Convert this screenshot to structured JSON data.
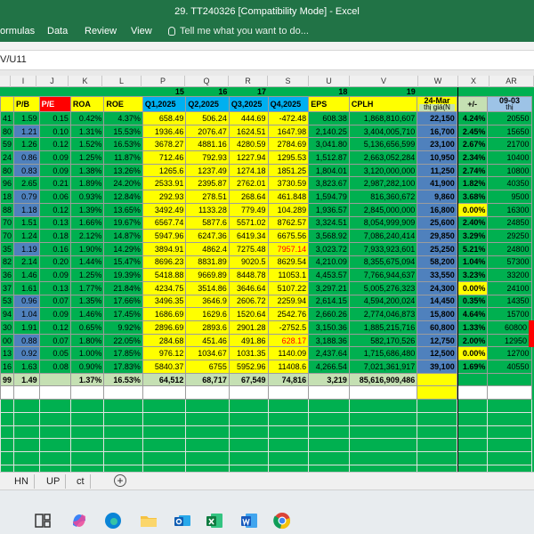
{
  "window": {
    "title": "29. TT240326  [Compatibility Mode] - Excel"
  },
  "ribbon": {
    "tabs": [
      "ormulas",
      "Data",
      "Review",
      "View"
    ],
    "tell_me": "Tell me what you want to do..."
  },
  "formula_bar": {
    "name_box": "V/U11"
  },
  "column_headers": [
    "I",
    "J",
    "K",
    "L",
    "P",
    "Q",
    "R",
    "S",
    "U",
    "V",
    "W",
    "X",
    "AR"
  ],
  "number_row": [
    "15",
    "16",
    "17",
    "18",
    "19"
  ],
  "header_row": {
    "pb": "P/B",
    "pe": "P/E",
    "roa": "ROA",
    "roe": "ROE",
    "q1": "Q1,2025",
    "q2": "Q2,2025",
    "q3": "Q3,2025",
    "q4": "Q4,2025",
    "eps": "EPS",
    "cplh": "CPLH",
    "date1": "24-Mar",
    "thi_gia": "thị giá(N",
    "pct": "+/-",
    "date2": "09-03",
    "thi": "thị"
  },
  "rows": [
    {
      "a": "41",
      "pb": "1.59",
      "pe": "0.15",
      "roa": "0.42%",
      "roe": "4.37%",
      "q1": "658.49",
      "q2": "506.24",
      "q3": "444.69",
      "q4": "-472.48",
      "eps": "608.38",
      "cplh": "1,868,810,607",
      "price": "22,150",
      "pct": "4.24%",
      "ar": "20550"
    },
    {
      "a": "80",
      "pb": "1.21",
      "pe": "0.10",
      "roa": "1.31%",
      "roe": "15.53%",
      "q1": "1936.46",
      "q2": "2076.47",
      "q3": "1624.51",
      "q4": "1647.98",
      "eps": "2,140.25",
      "cplh": "3,404,005,710",
      "price": "16,700",
      "pct": "2.45%",
      "ar": "15650"
    },
    {
      "a": "59",
      "pb": "1.26",
      "pe": "0.12",
      "roa": "1.52%",
      "roe": "16.53%",
      "q1": "3678.27",
      "q2": "4881.16",
      "q3": "4280.59",
      "q4": "2784.69",
      "eps": "3,041.80",
      "cplh": "5,136,656,599",
      "price": "23,100",
      "pct": "2.67%",
      "ar": "21700"
    },
    {
      "a": "24",
      "pb": "0.86",
      "pe": "0.09",
      "roa": "1.25%",
      "roe": "11.87%",
      "q1": "712.46",
      "q2": "792.93",
      "q3": "1227.94",
      "q4": "1295.53",
      "eps": "1,512.87",
      "cplh": "2,663,052,284",
      "price": "10,950",
      "pct": "2.34%",
      "ar": "10400"
    },
    {
      "a": "80",
      "pb": "0.83",
      "pe": "0.09",
      "roa": "1.38%",
      "roe": "13.26%",
      "q1": "1265.6",
      "q2": "1237.49",
      "q3": "1274.18",
      "q4": "1851.25",
      "eps": "1,804.01",
      "cplh": "3,120,000,000",
      "price": "11,250",
      "pct": "2.74%",
      "ar": "10800"
    },
    {
      "a": "96",
      "pb": "2.65",
      "pe": "0.21",
      "roa": "1.89%",
      "roe": "24.20%",
      "q1": "2533.91",
      "q2": "2395.87",
      "q3": "2762.01",
      "q4": "3730.59",
      "eps": "3,823.67",
      "cplh": "2,987,282,100",
      "price": "41,900",
      "pct": "1.82%",
      "ar": "40350"
    },
    {
      "a": "18",
      "pb": "0.79",
      "pe": "0.06",
      "roa": "0.93%",
      "roe": "12.84%",
      "q1": "292.93",
      "q2": "278.51",
      "q3": "268.64",
      "q4": "461.848",
      "eps": "1,594.79",
      "cplh": "816,360,672",
      "price": "9,860",
      "pct": "3.68%",
      "ar": "9500"
    },
    {
      "a": "88",
      "pb": "1.18",
      "pe": "0.12",
      "roa": "1.39%",
      "roe": "13.65%",
      "q1": "3492.49",
      "q2": "1133.28",
      "q3": "779.49",
      "q4": "104.289",
      "eps": "1,936.57",
      "cplh": "2,845,000,000",
      "price": "16,800",
      "pct": "0.00%",
      "ar": "16300"
    },
    {
      "a": "70",
      "pb": "1.51",
      "pe": "0.13",
      "roa": "1.66%",
      "roe": "19.67%",
      "q1": "6567.74",
      "q2": "5877.6",
      "q3": "5571.02",
      "q4": "8762.57",
      "eps": "3,324.51",
      "cplh": "8,054,999,909",
      "price": "25,600",
      "pct": "2.40%",
      "ar": "24850"
    },
    {
      "a": "70",
      "pb": "1.24",
      "pe": "0.18",
      "roa": "2.12%",
      "roe": "14.87%",
      "q1": "5947.96",
      "q2": "6247.36",
      "q3": "6419.34",
      "q4": "6675.56",
      "eps": "3,568.92",
      "cplh": "7,086,240,414",
      "price": "29,850",
      "pct": "3.29%",
      "ar": "29250"
    },
    {
      "a": "35",
      "pb": "1.19",
      "pe": "0.16",
      "roa": "1.90%",
      "roe": "14.29%",
      "q1": "3894.91",
      "q2": "4862.4",
      "q3": "7275.48",
      "q4": "7957.14",
      "eps": "3,023.72",
      "cplh": "7,933,923,601",
      "price": "25,250",
      "pct": "5.21%",
      "ar": "24800"
    },
    {
      "a": "82",
      "pb": "2.14",
      "pe": "0.20",
      "roa": "1.44%",
      "roe": "15.47%",
      "q1": "8696.23",
      "q2": "8831.89",
      "q3": "9020.5",
      "q4": "8629.54",
      "eps": "4,210.09",
      "cplh": "8,355,675,094",
      "price": "58,200",
      "pct": "1.04%",
      "ar": "57300"
    },
    {
      "a": "36",
      "pb": "1.46",
      "pe": "0.09",
      "roa": "1.25%",
      "roe": "19.39%",
      "q1": "5418.88",
      "q2": "9669.89",
      "q3": "8448.78",
      "q4": "11053.1",
      "eps": "4,453.57",
      "cplh": "7,766,944,637",
      "price": "33,550",
      "pct": "3.23%",
      "ar": "33200"
    },
    {
      "a": "37",
      "pb": "1.61",
      "pe": "0.13",
      "roa": "1.77%",
      "roe": "21.84%",
      "q1": "4234.75",
      "q2": "3514.86",
      "q3": "3646.64",
      "q4": "5107.22",
      "eps": "3,297.21",
      "cplh": "5,005,276,323",
      "price": "24,300",
      "pct": "0.00%",
      "ar": "24100"
    },
    {
      "a": "53",
      "pb": "0.96",
      "pe": "0.07",
      "roa": "1.35%",
      "roe": "17.66%",
      "q1": "3496.35",
      "q2": "3646.9",
      "q3": "2606.72",
      "q4": "2259.94",
      "eps": "2,614.15",
      "cplh": "4,594,200,024",
      "price": "14,450",
      "pct": "0.35%",
      "ar": "14350"
    },
    {
      "a": "94",
      "pb": "1.04",
      "pe": "0.09",
      "roa": "1.46%",
      "roe": "17.45%",
      "q1": "1686.69",
      "q2": "1629.6",
      "q3": "1520.64",
      "q4": "2542.76",
      "eps": "2,660.26",
      "cplh": "2,774,046,873",
      "price": "15,800",
      "pct": "4.64%",
      "ar": "15700"
    },
    {
      "a": "30",
      "pb": "1.91",
      "pe": "0.12",
      "roa": "0.65%",
      "roe": "9.92%",
      "q1": "2896.69",
      "q2": "2893.6",
      "q3": "2901.28",
      "q4": "-2752.5",
      "eps": "3,150.36",
      "cplh": "1,885,215,716",
      "price": "60,800",
      "pct": "1.33%",
      "ar": "60800"
    },
    {
      "a": "00",
      "pb": "0.88",
      "pe": "0.07",
      "roa": "1.80%",
      "roe": "22.05%",
      "q1": "284.68",
      "q2": "451.46",
      "q3": "491.86",
      "q4": "628.17",
      "eps": "3,188.36",
      "cplh": "582,170,526",
      "price": "12,750",
      "pct": "2.00%",
      "ar": "12950"
    },
    {
      "a": "13",
      "pb": "0.92",
      "pe": "0.05",
      "roa": "1.00%",
      "roe": "17.85%",
      "q1": "976.12",
      "q2": "1034.67",
      "q3": "1031.35",
      "q4": "1140.09",
      "eps": "2,437.64",
      "cplh": "1,715,686,480",
      "price": "12,500",
      "pct": "0.00%",
      "ar": "12700"
    },
    {
      "a": "16",
      "pb": "1.63",
      "pe": "0.08",
      "roa": "0.90%",
      "roe": "17.83%",
      "q1": "5840.37",
      "q2": "6755",
      "q3": "5952.96",
      "q4": "11408.6",
      "eps": "4,266.54",
      "cplh": "7,021,361,917",
      "price": "39,100",
      "pct": "1.69%",
      "ar": "40550"
    }
  ],
  "totals": {
    "a": "99",
    "pb": "1.49",
    "roa": "1.37%",
    "roe": "16.53%",
    "q1": "64,512",
    "q2": "68,717",
    "q3": "67,549",
    "q4": "74,816",
    "eps": "3,219",
    "cplh": "85,616,909,486"
  },
  "sheet_tabs": [
    "HN",
    "UP",
    "ct"
  ],
  "taskbar_icons": [
    "task-view-icon",
    "copilot-icon",
    "edge-icon",
    "file-explorer-icon",
    "outlook-icon",
    "excel-icon",
    "word-icon",
    "chrome-icon"
  ]
}
